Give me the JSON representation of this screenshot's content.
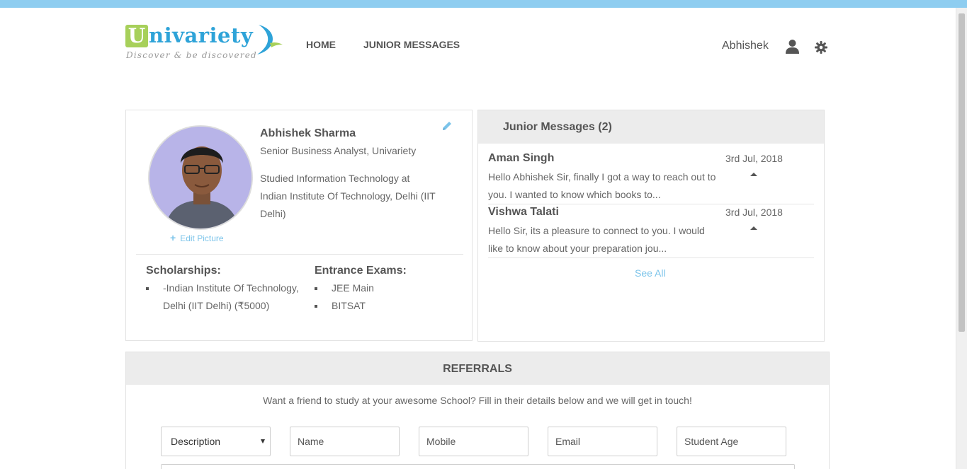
{
  "brand": {
    "logo_letter": "U",
    "logo_rest": "nivariety",
    "tagline": "Discover & be discovered"
  },
  "nav": {
    "home": "HOME",
    "junior_messages": "JUNIOR MESSAGES"
  },
  "user": {
    "name": "Abhishek"
  },
  "profile": {
    "name": "Abhishek Sharma",
    "title": "Senior Business Analyst, Univariety",
    "education": "Studied Information Technology at Indian Institute Of Technology, Delhi (IIT Delhi)",
    "edit_picture": "Edit Picture",
    "scholarships_title": "Scholarships:",
    "scholarships": [
      "-Indian Institute Of Technology, Delhi (IIT Delhi) (₹5000)"
    ],
    "entrance_title": "Entrance Exams:",
    "entrance_exams": [
      "JEE Main",
      "BITSAT"
    ]
  },
  "messages": {
    "title": "Junior Messages (2)",
    "items": [
      {
        "name": "Aman Singh",
        "date": "3rd Jul, 2018",
        "text": "Hello Abhishek Sir, finally I got a way to reach out to you. I wanted to know which books to..."
      },
      {
        "name": "Vishwa Talati",
        "date": "3rd Jul, 2018",
        "text": "Hello Sir, its a pleasure to connect to you. I would like to know about your preparation jou..."
      }
    ],
    "see_all": "See All"
  },
  "referrals": {
    "title": "REFERRALS",
    "subtitle": "Want a friend to study at your awesome School? Fill in their details below and we will get in touch!",
    "description_select": "Description",
    "name_placeholder": "Name",
    "mobile_placeholder": "Mobile",
    "email_placeholder": "Email",
    "age_placeholder": "Student Age"
  },
  "colors": {
    "accent": "#7cc4ea",
    "topbar": "#8ecdf0",
    "logo_green": "#a7d05a",
    "logo_blue": "#2ea3d8"
  }
}
